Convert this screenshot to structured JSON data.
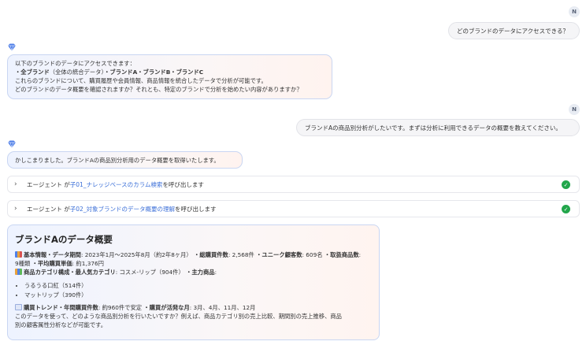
{
  "user1": {
    "avatar": "N",
    "text": "どのブランドのデータにアクセスできる？"
  },
  "ai1": {
    "line1": "以下のブランドのデータにアクセスできます：",
    "line2_bold1": "・全ブランド",
    "line2_normal1": "（全体の統合データ）",
    "line2_bold2": "・ブランドA・ブランドB・ブランドC",
    "line3": "これらのブランドについて、購買履歴や会員情報、商品情報を統合したデータで分析が可能です。",
    "line4": "どのブランドのデータ概要を確認されますか？それとも、特定のブランドで分析を始めたい内容がありますか？"
  },
  "user2": {
    "avatar": "N",
    "text": "ブランドAの商品別分析がしたいです。まずは分析に利用できるデータの概要を教えてください。"
  },
  "ai2": {
    "text": "かしこまりました。ブランドAの商品別分析用のデータ概要を取得いたします。"
  },
  "agents": [
    {
      "prefix": "エージェント が ",
      "link": "子01_ナレッジベースのカラム検索",
      "suffix": " を呼び出します"
    },
    {
      "prefix": "エージェント が ",
      "link": "子02_対象ブランドのデータ概要の理解",
      "suffix": " を呼び出します"
    }
  ],
  "card": {
    "title": "ブランドAのデータ概要",
    "basic_label": "基本情報・データ期間",
    "basic_value": ": 2023年1月〜2025年8月（約2年8ヶ月）",
    "total_label": "・総購買件数",
    "total_value": ": 2,568件",
    "unique_label": "・ユニーク顧客数",
    "unique_value": ": 609名",
    "items_label": "・取扱商品数",
    "items_value": ":",
    "items_value2": "9種類",
    "avg_label": "・平均購買単価",
    "avg_value": ": 約1,376円",
    "cat_label": "商品カテゴリ構成・最人気カテゴリ",
    "cat_value": ": コスメ-リップ（904件）",
    "main_label": "・主力商品",
    "main_value": ":",
    "products": [
      "うるうる口紅（514件）",
      "マットリップ（390件）"
    ],
    "trend_label": "購買トレンド・年間購買件数",
    "trend_value": ": 約960件で安定",
    "active_label": "・購買が活発な月",
    "active_value": ": 3月、4月、11月、12月",
    "closing1": "このデータを使って、どのような商品別分析を行いたいですか？例えば、商品カテゴリ別の売上比較、期間別の売上推移、商品",
    "closing2": "別の顧客属性分析などが可能です。"
  },
  "colors": {
    "accent_link": "#3b6fd8",
    "check_green": "#22a64b",
    "ai_icon": "#4f7fe8"
  }
}
